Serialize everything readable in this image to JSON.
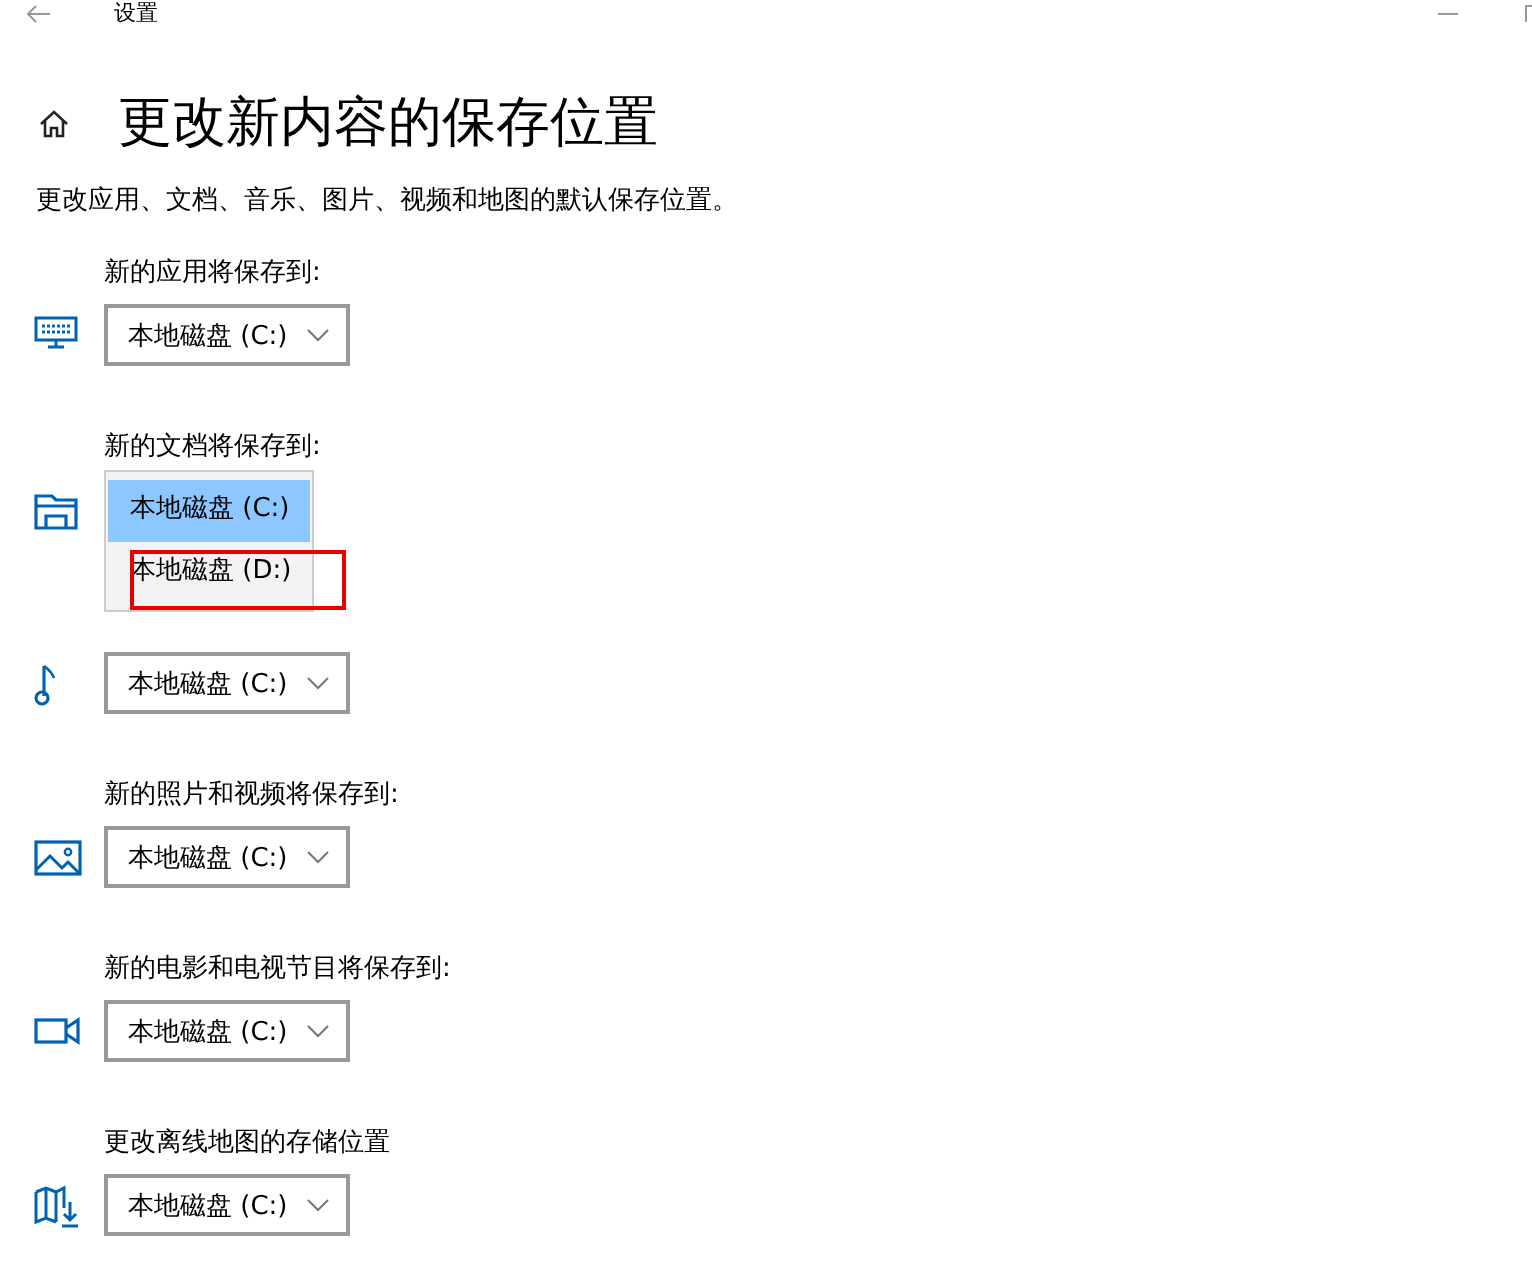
{
  "window": {
    "title": "设置"
  },
  "page": {
    "title": "更改新内容的保存位置",
    "description": "更改应用、文档、音乐、图片、视频和地图的默认保存位置。"
  },
  "sections": [
    {
      "kind": "apps",
      "label": "新的应用将保存到:",
      "value": "本地磁盘 (C:)"
    },
    {
      "kind": "documents",
      "label": "新的文档将保存到:",
      "options": [
        {
          "label": "本地磁盘 (C:)",
          "selected": true,
          "highlighted": false
        },
        {
          "label": "本地磁盘 (D:)",
          "selected": false,
          "highlighted": true
        }
      ]
    },
    {
      "kind": "music",
      "value": "本地磁盘 (C:)"
    },
    {
      "kind": "photos",
      "label": "新的照片和视频将保存到:",
      "value": "本地磁盘 (C:)"
    },
    {
      "kind": "movies",
      "label": "新的电影和电视节目将保存到:",
      "value": "本地磁盘 (C:)"
    },
    {
      "kind": "maps",
      "label": "更改离线地图的存储位置",
      "value": "本地磁盘 (C:)"
    }
  ]
}
